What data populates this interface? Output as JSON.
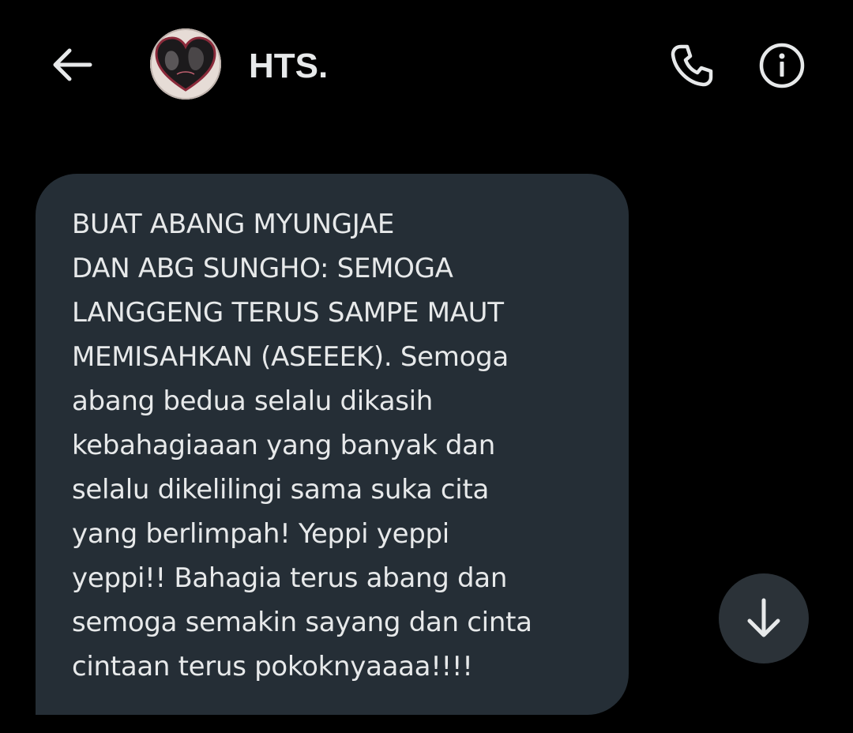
{
  "header": {
    "title": "HTS.",
    "back_icon": "arrow-left-icon",
    "avatar_icon": "heart-photo-avatar",
    "call_icon": "phone-icon",
    "info_icon": "info-circle-icon"
  },
  "message": {
    "text": "BUAT ABANG MYUNGJAE\nDAN ABG SUNGHO: SEMOGA\nLANGGENG TERUS SAMPE MAUT\nMEMISAHKAN (ASEEEK). Semoga\nabang bedua selalu dikasih\nkebahagiaaan yang banyak dan\nselalu dikelilingi sama suka cita\nyang berlimpah! Yeppi yeppi\nyeppi!! Bahagia terus abang dan\nsemoga semakin sayang dan cinta\ncintaan terus pokoknyaaaa!!!!"
  },
  "scroll_button": {
    "icon": "arrow-down-icon"
  },
  "colors": {
    "background": "#000000",
    "bubble": "#252e36",
    "text": "#e7e9ea",
    "scroll_button": "#2b3238"
  }
}
